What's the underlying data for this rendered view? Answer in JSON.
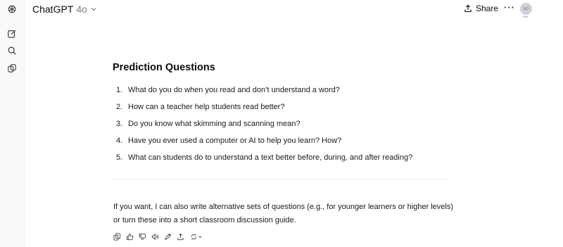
{
  "header": {
    "model_name": "ChatGPT",
    "model_version": "4o",
    "share_label": "Share",
    "more_label": "···",
    "avatar_initials": "SO",
    "avatar_sub": "Rick"
  },
  "sidebar": {
    "icons": [
      "logo-icon",
      "new-chat-icon",
      "search-icon",
      "library-icon"
    ]
  },
  "message": {
    "heading": "Prediction Questions",
    "questions": [
      {
        "num": "1.",
        "text": "What do you do when you read and don’t understand a word?"
      },
      {
        "num": "2.",
        "text": "How can a teacher help students read better?"
      },
      {
        "num": "3.",
        "text": "Do you know what skimming and scanning mean?"
      },
      {
        "num": "4.",
        "text": "Have you ever used a computer or AI to help you learn? How?"
      },
      {
        "num": "5.",
        "text": "What can students do to understand a text better before, during, and after reading?"
      }
    ],
    "followup_line1": "If you want, I can also write alternative sets of questions (e.g., for younger learners or higher levels)",
    "followup_line2": "or turn these into a short classroom discussion guide."
  },
  "actions": [
    "copy-icon",
    "thumbs-up-icon",
    "thumbs-down-icon",
    "read-aloud-icon",
    "edit-canvas-icon",
    "share-icon",
    "regenerate-icon"
  ],
  "colors": {
    "text": "#0d0d0d",
    "muted": "#7d7d7d",
    "sidebar_bg": "#f9f9f9",
    "avatar_bg": "#cfd3d9"
  }
}
